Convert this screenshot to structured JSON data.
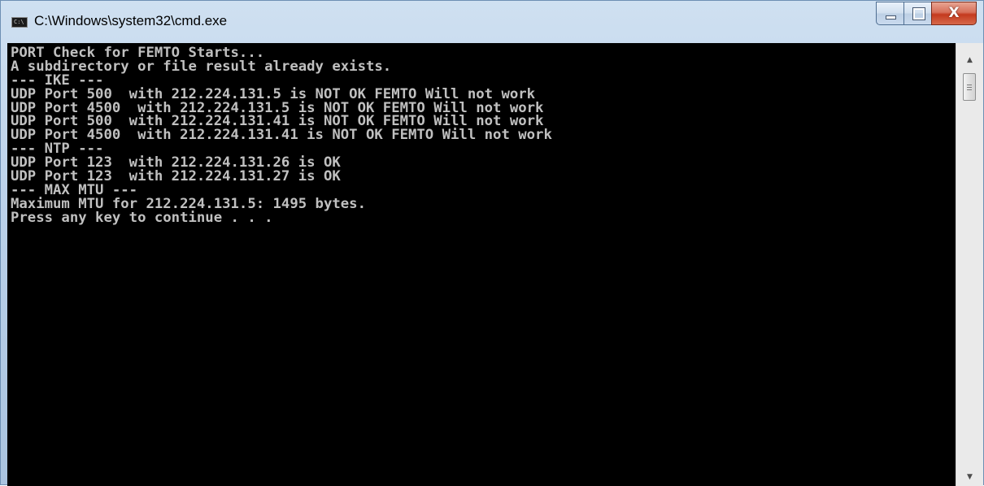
{
  "window": {
    "title": "C:\\Windows\\system32\\cmd.exe",
    "icon": "cmd-icon",
    "icon_text": "C:\\",
    "buttons": {
      "minimize_icon": "minimize-icon",
      "maximize_icon": "maximize-icon",
      "close_icon": "close-icon",
      "close_glyph": "X"
    }
  },
  "console": {
    "lines": [
      "PORT Check for FEMTO Starts...",
      "A subdirectory or file result already exists.",
      "--- IKE ---",
      "UDP Port 500  with 212.224.131.5 is NOT OK FEMTO Will not work",
      "UDP Port 4500  with 212.224.131.5 is NOT OK FEMTO Will not work",
      "UDP Port 500  with 212.224.131.41 is NOT OK FEMTO Will not work",
      "UDP Port 4500  with 212.224.131.41 is NOT OK FEMTO Will not work",
      "--- NTP ---",
      "UDP Port 123  with 212.224.131.26 is OK",
      "UDP Port 123  with 212.224.131.27 is OK",
      "--- MAX MTU ---",
      "Maximum MTU for 212.224.131.5: 1495 bytes.",
      "Press any key to continue . . ."
    ],
    "text_color": "#c0c0c0",
    "background_color": "#000000"
  },
  "scrollbar": {
    "up_icon": "scroll-up-arrow-icon",
    "down_icon": "scroll-down-arrow-icon",
    "up_glyph": "▲",
    "down_glyph": "▼"
  }
}
